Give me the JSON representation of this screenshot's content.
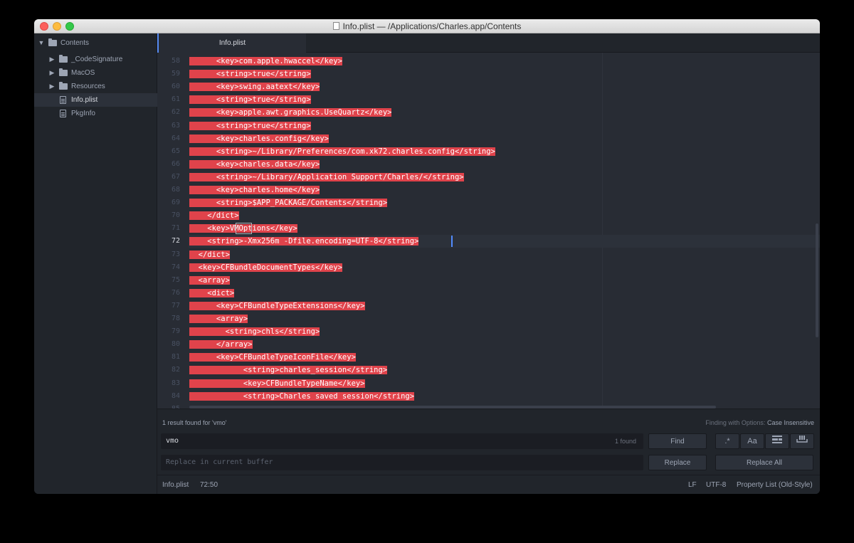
{
  "window": {
    "title": "Info.plist — /Applications/Charles.app/Contents"
  },
  "sidebar": {
    "root": "Contents",
    "items": [
      {
        "label": "_CodeSignature",
        "type": "folder"
      },
      {
        "label": "MacOS",
        "type": "folder"
      },
      {
        "label": "Resources",
        "type": "folder"
      },
      {
        "label": "Info.plist",
        "type": "file",
        "selected": true
      },
      {
        "label": "PkgInfo",
        "type": "file"
      }
    ]
  },
  "tab": {
    "label": "Info.plist"
  },
  "editor": {
    "current_line": 72,
    "lines": [
      {
        "n": "58",
        "text": "      <key>com.apple.hwaccel</key>"
      },
      {
        "n": "59",
        "text": "      <string>true</string>"
      },
      {
        "n": "60",
        "text": "      <key>swing.aatext</key>"
      },
      {
        "n": "61",
        "text": "      <string>true</string>"
      },
      {
        "n": "62",
        "text": "      <key>apple.awt.graphics.UseQuartz</key>"
      },
      {
        "n": "63",
        "text": "      <string>true</string>"
      },
      {
        "n": "64",
        "text": "      <key>charles.config</key>"
      },
      {
        "n": "65",
        "text": "      <string>~/Library/Preferences/com.xk72.charles.config</string>"
      },
      {
        "n": "66",
        "text": "      <key>charles.data</key>"
      },
      {
        "n": "67",
        "text": "      <string>~/Library/Application Support/Charles/</string>"
      },
      {
        "n": "68",
        "text": "      <key>charles.home</key>"
      },
      {
        "n": "69",
        "text": "      <string>$APP_PACKAGE/Contents</string>"
      },
      {
        "n": "70",
        "text": "    </dict>"
      },
      {
        "n": "71",
        "text": "    <key>VMOptions</key>"
      },
      {
        "n": "72",
        "text": "    <string>-Xmx256m -Dfile.encoding=UTF-8</string>"
      },
      {
        "n": "73",
        "text": "  </dict>"
      },
      {
        "n": "74",
        "text": "  <key>CFBundleDocumentTypes</key>"
      },
      {
        "n": "75",
        "text": "  <array>"
      },
      {
        "n": "76",
        "text": "    <dict>"
      },
      {
        "n": "77",
        "text": "      <key>CFBundleTypeExtensions</key>"
      },
      {
        "n": "78",
        "text": "      <array>"
      },
      {
        "n": "79",
        "text": "        <string>chls</string>"
      },
      {
        "n": "80",
        "text": "      </array>"
      },
      {
        "n": "81",
        "text": "      <key>CFBundleTypeIconFile</key>"
      },
      {
        "n": "82",
        "text": "            <string>charles_session</string>"
      },
      {
        "n": "83",
        "text": "            <key>CFBundleTypeName</key>"
      },
      {
        "n": "84",
        "text": "            <string>Charles saved session</string>"
      },
      {
        "n": "85",
        "text": ""
      }
    ]
  },
  "find": {
    "result_text": "1 result found for 'vmo'",
    "options_label": "Finding with Options:",
    "options_value": "Case Insensitive",
    "query": "vmo",
    "found_count": "1 found",
    "replace_placeholder": "Replace in current buffer",
    "find_button": "Find",
    "replace_button": "Replace",
    "replace_all_button": "Replace All",
    "regex_label": ".*",
    "case_label": "Aa"
  },
  "status": {
    "file": "Info.plist",
    "position": "72:50",
    "line_ending": "LF",
    "encoding": "UTF-8",
    "grammar": "Property List (Old-Style)"
  },
  "colors": {
    "selection": "#e0434b",
    "cursor": "#528bff",
    "background": "#282c34",
    "panel": "#21252b"
  }
}
